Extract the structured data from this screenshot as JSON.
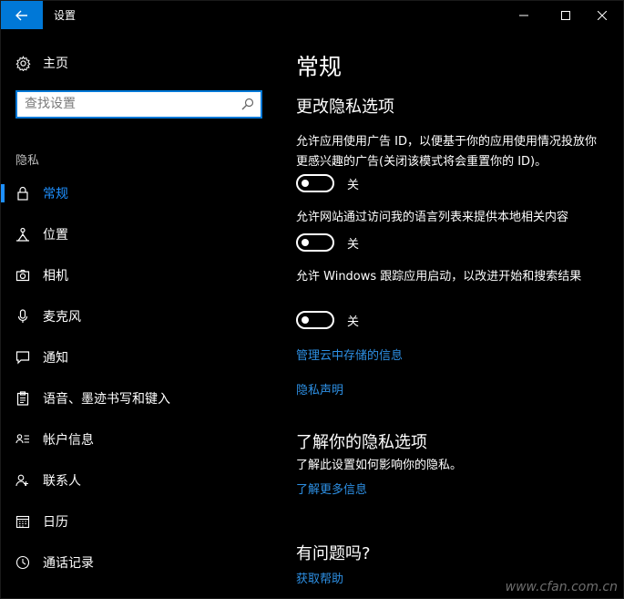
{
  "window": {
    "title": "设置"
  },
  "sidebar": {
    "home_label": "主页",
    "search_placeholder": "查找设置",
    "section_label": "隐私",
    "items": [
      {
        "label": "常规",
        "icon": "lock-icon",
        "selected": true
      },
      {
        "label": "位置",
        "icon": "location-icon",
        "selected": false
      },
      {
        "label": "相机",
        "icon": "camera-icon",
        "selected": false
      },
      {
        "label": "麦克风",
        "icon": "microphone-icon",
        "selected": false
      },
      {
        "label": "通知",
        "icon": "notification-icon",
        "selected": false
      },
      {
        "label": "语音、墨迹书写和键入",
        "icon": "clipboard-icon",
        "selected": false
      },
      {
        "label": "帐户信息",
        "icon": "account-info-icon",
        "selected": false
      },
      {
        "label": "联系人",
        "icon": "contacts-icon",
        "selected": false
      },
      {
        "label": "日历",
        "icon": "calendar-icon",
        "selected": false
      },
      {
        "label": "通话记录",
        "icon": "call-history-icon",
        "selected": false
      }
    ]
  },
  "main": {
    "page_title": "常规",
    "section_title": "更改隐私选项",
    "options": [
      {
        "description": "允许应用使用广告 ID，以便基于你的应用使用情况投放你更感兴趣的广告(关闭该模式将会重置你的 ID)。",
        "state": "关"
      },
      {
        "description": "允许网站通过访问我的语言列表来提供本地相关内容",
        "state": "关"
      },
      {
        "description": "允许 Windows 跟踪应用启动，以改进开始和搜索结果",
        "state": "关"
      }
    ],
    "link_cloud": "管理云中存储的信息",
    "link_privacy_statement": "隐私声明",
    "learn_title": "了解你的隐私选项",
    "learn_desc": "了解此设置如何影响你的隐私。",
    "learn_link": "了解更多信息",
    "help_title": "有问题吗?",
    "help_link": "获取帮助"
  },
  "watermark": "www.cfan.com.cn",
  "colors": {
    "accent": "#0078d7",
    "link": "#2d8fe3",
    "background": "#000000"
  }
}
